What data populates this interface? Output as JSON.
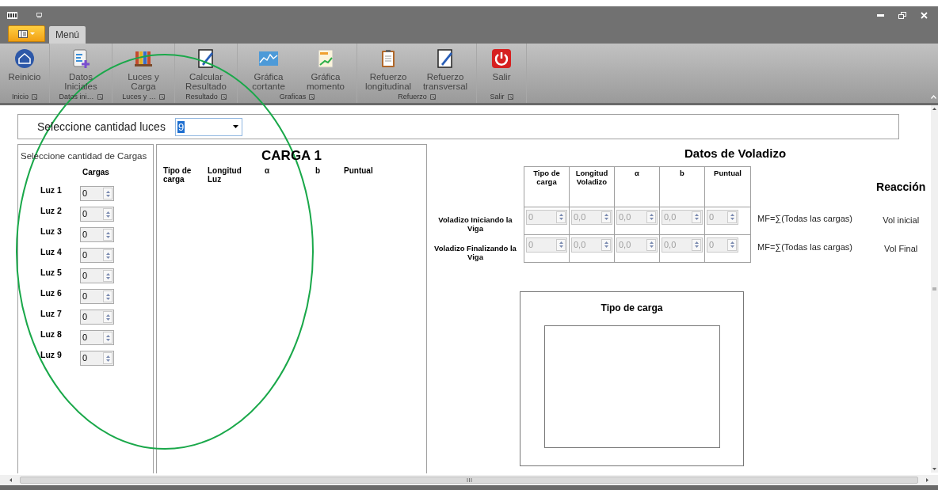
{
  "menu_tab": {
    "label": "Menú",
    "selected": true
  },
  "ribbon": {
    "groups": [
      {
        "label": "Inicio",
        "buttons": [
          "Reinicio"
        ]
      },
      {
        "label": "Datos ini…",
        "buttons": [
          "Datos Iniciales"
        ]
      },
      {
        "label": "Luces y …",
        "buttons": [
          "Luces y Carga"
        ]
      },
      {
        "label": "Resultado",
        "buttons": [
          "Calcular Resultado"
        ]
      },
      {
        "label": "Graficas",
        "buttons": [
          "Gráfica cortante",
          "Gráfica momento"
        ]
      },
      {
        "label": "Refuerzo",
        "buttons": [
          "Refuerzo longitudinal",
          "Refuerzo transversal"
        ]
      },
      {
        "label": "Salir",
        "buttons": [
          "Salir"
        ]
      }
    ]
  },
  "luces_selector": {
    "label": "Seleccione cantidad luces",
    "value": "9"
  },
  "cargas_panel": {
    "title": "Seleccione cantidad de Cargas",
    "column": "Cargas",
    "rows": [
      {
        "label": "Luz 1",
        "value": "0"
      },
      {
        "label": "Luz 2",
        "value": "0"
      },
      {
        "label": "Luz 3",
        "value": "0"
      },
      {
        "label": "Luz 4",
        "value": "0"
      },
      {
        "label": "Luz 5",
        "value": "0"
      },
      {
        "label": "Luz 6",
        "value": "0"
      },
      {
        "label": "Luz 7",
        "value": "0"
      },
      {
        "label": "Luz 8",
        "value": "0"
      },
      {
        "label": "Luz 9",
        "value": "0"
      }
    ]
  },
  "carga_panel": {
    "title": "CARGA 1",
    "columns": [
      "Tipo de carga",
      "Longitud Luz",
      "α",
      "b",
      "Puntual"
    ]
  },
  "voladizo": {
    "title": "Datos de Voladizo",
    "columns": [
      "Tipo de carga",
      "Longitud Voladizo",
      "α",
      "b",
      "Puntual"
    ],
    "reaction_heading": "Reacción",
    "rows": [
      {
        "label": "Voladizo Iniciando la Viga",
        "values": [
          "0",
          "0,0",
          "0,0",
          "0,0",
          "0"
        ],
        "disabled": true,
        "formula": "MF=∑(Todas las cargas)",
        "reaction": "Vol inicial"
      },
      {
        "label": "Voladizo Finalizando la Viga",
        "values": [
          "0",
          "0,0",
          "0,0",
          "0,0",
          "0"
        ],
        "disabled": true,
        "formula": "MF=∑(Todas las cargas)",
        "reaction": "Vol Final"
      }
    ]
  },
  "tipo_carga_box": {
    "title": "Tipo de carga"
  }
}
